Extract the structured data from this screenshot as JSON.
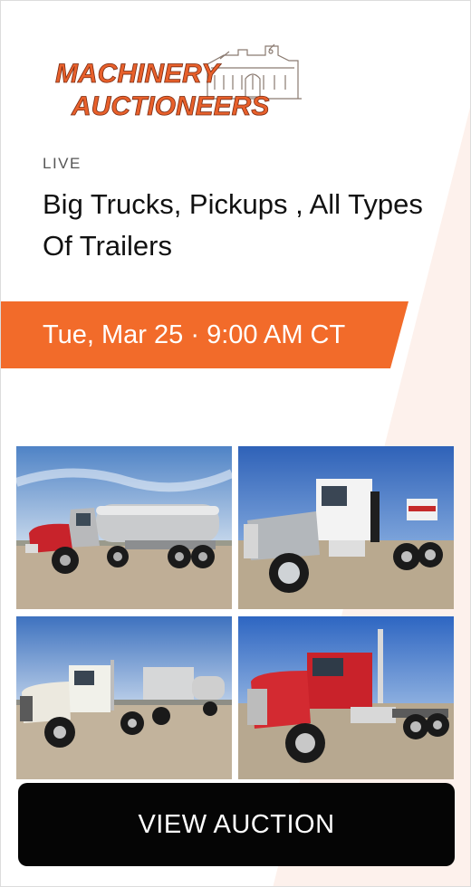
{
  "brand": {
    "logo_line1": "MACHINERY",
    "logo_line2": "AUCTIONEERS"
  },
  "colors": {
    "accent": "#f26b2a",
    "logo_text": "#e8602b",
    "background_stripe": "#fdf1ec",
    "button_bg": "#050505"
  },
  "auction": {
    "status": "LIVE",
    "title": "Big Trucks, Pickups , All Types Of Trailers",
    "date": "Tue, Mar 25",
    "separator": "·",
    "time": "9:00 AM CT"
  },
  "photos": [
    {
      "subject": "silver fuel tanker truck with red hood"
    },
    {
      "subject": "silver Peterbilt day cab tractor"
    },
    {
      "subject": "white Mack tractor pulling tank trailers"
    },
    {
      "subject": "red Mack tractor with chrome stacks"
    }
  ],
  "actions": {
    "view_label": "VIEW AUCTION"
  }
}
